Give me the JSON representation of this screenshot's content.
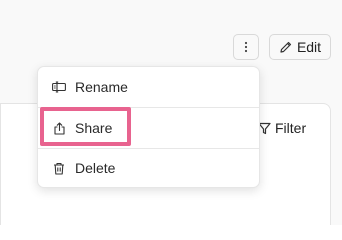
{
  "toolbar": {
    "edit_label": "Edit",
    "more_icon": "more-vertical-icon",
    "edit_icon": "pencil-icon"
  },
  "content": {
    "filter_label": "Filter",
    "filter_icon": "filter-icon"
  },
  "menu": {
    "items": [
      {
        "label": "Rename",
        "icon": "rename-icon"
      },
      {
        "label": "Share",
        "icon": "share-icon",
        "highlighted": true
      },
      {
        "label": "Delete",
        "icon": "trash-icon"
      }
    ]
  },
  "colors": {
    "highlight": "#e8638f"
  }
}
